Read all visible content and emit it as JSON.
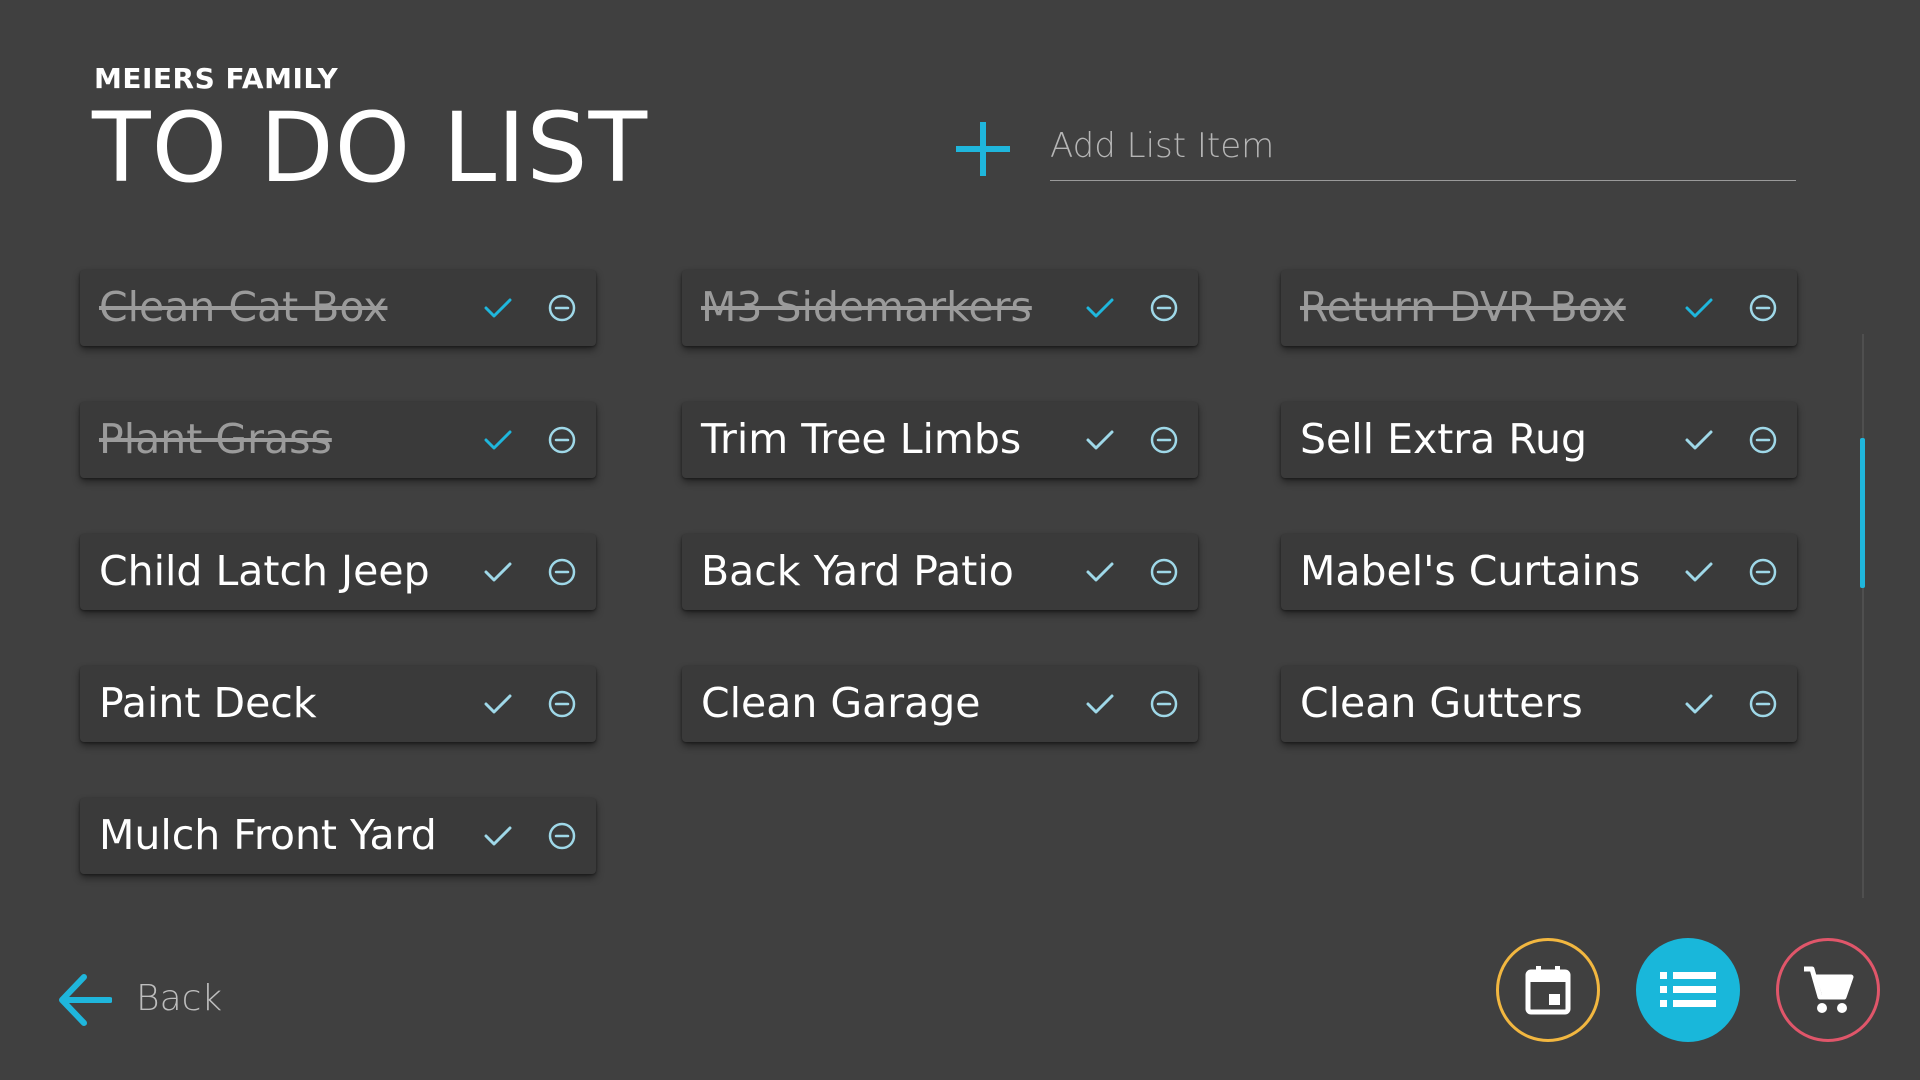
{
  "header": {
    "family_name": "MEIERS FAMILY",
    "title": "TO DO LIST"
  },
  "add_item": {
    "placeholder": "Add List Item",
    "value": "",
    "icon": "plus-icon"
  },
  "items": [
    {
      "label": "Clean Cat Box",
      "done": true
    },
    {
      "label": "M3 Sidemarkers",
      "done": true
    },
    {
      "label": "Return DVR Box",
      "done": true
    },
    {
      "label": "Plant Grass",
      "done": true
    },
    {
      "label": "Trim Tree Limbs",
      "done": false
    },
    {
      "label": "Sell Extra Rug",
      "done": false
    },
    {
      "label": "Child Latch Jeep",
      "done": false
    },
    {
      "label": "Back Yard Patio",
      "done": false
    },
    {
      "label": "Mabel's Curtains",
      "done": false
    },
    {
      "label": "Paint Deck",
      "done": false
    },
    {
      "label": "Clean Garage",
      "done": false
    },
    {
      "label": "Clean Gutters",
      "done": false
    },
    {
      "label": "Mulch Front Yard",
      "done": false
    }
  ],
  "footer": {
    "back_label": "Back",
    "back_icon": "arrow-left-icon",
    "nav": [
      {
        "name": "calendar",
        "icon": "calendar-icon",
        "color": "#f2b740",
        "active": false
      },
      {
        "name": "list",
        "icon": "list-icon",
        "color": "#19b7da",
        "active": true
      },
      {
        "name": "cart",
        "icon": "cart-icon",
        "color": "#e0566a",
        "active": false
      }
    ]
  },
  "colors": {
    "background": "#404040",
    "card": "#3a3a3a",
    "accent": "#1fb6dc",
    "check_done": "#1fb6dc",
    "check_pending": "#9fd8e8"
  }
}
